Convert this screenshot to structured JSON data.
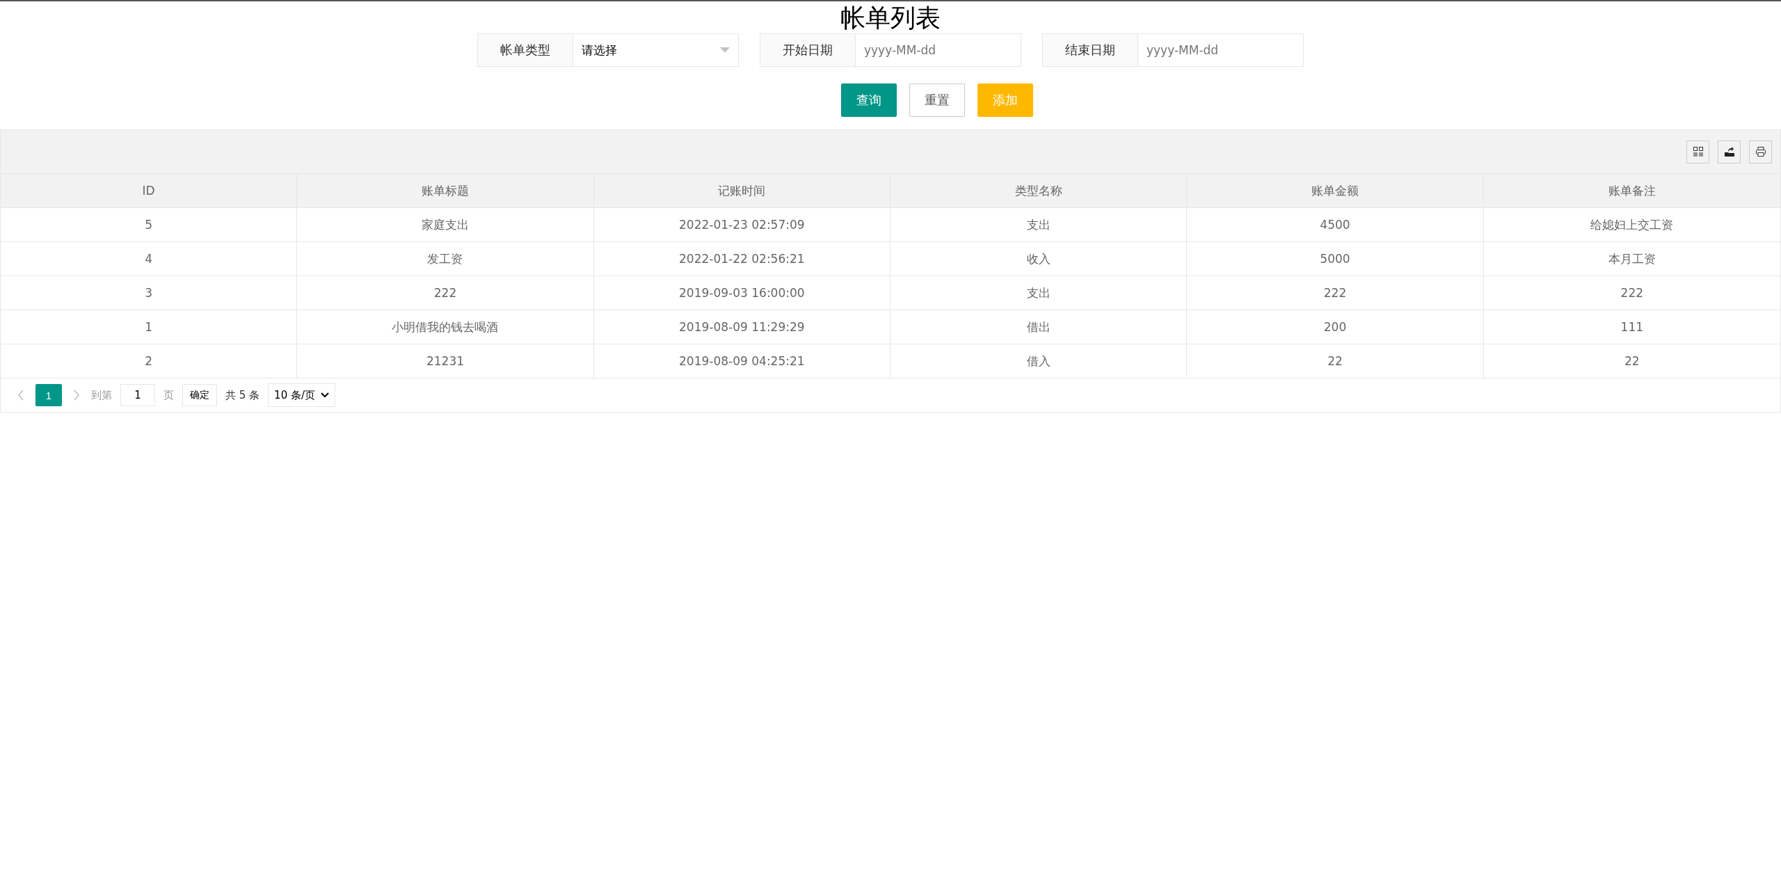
{
  "title": "帐单列表",
  "filters": [
    {
      "kind": "select",
      "label": "帐单类型",
      "value": "请选择"
    },
    {
      "kind": "date",
      "label": "开始日期",
      "placeholder": "yyyy-MM-dd"
    },
    {
      "kind": "date",
      "label": "结束日期",
      "placeholder": "yyyy-MM-dd"
    }
  ],
  "buttons": [
    {
      "kind": "primary",
      "label": "查询"
    },
    {
      "kind": "plain",
      "label": "重置"
    },
    {
      "kind": "warm",
      "label": "添加"
    }
  ],
  "table": {
    "columns": [
      "ID",
      "账单标题",
      "记账时间",
      "类型名称",
      "账单金额",
      "账单备注"
    ],
    "rows": [
      {
        "cells": [
          "5",
          "家庭支出",
          "2022-01-23 02:57:09",
          "支出",
          "4500",
          "给媳妇上交工资"
        ]
      },
      {
        "cells": [
          "4",
          "发工资",
          "2022-01-22 02:56:21",
          "收入",
          "5000",
          "本月工资"
        ]
      },
      {
        "cells": [
          "3",
          "222",
          "2019-09-03 16:00:00",
          "支出",
          "222",
          "222"
        ]
      },
      {
        "cells": [
          "1",
          "小明借我的钱去喝酒",
          "2019-08-09 11:29:29",
          "借出",
          "200",
          "111"
        ]
      },
      {
        "cells": [
          "2",
          "21231",
          "2019-08-09 04:25:21",
          "借入",
          "22",
          "22"
        ]
      }
    ]
  },
  "pager": {
    "pages": [
      {
        "label": "1",
        "selected": true
      }
    ],
    "goto_label": "到第",
    "goto_value": "1",
    "page_unit": "页",
    "confirm": "确定",
    "total": "共 5 条",
    "page_size": "10 条/页"
  }
}
